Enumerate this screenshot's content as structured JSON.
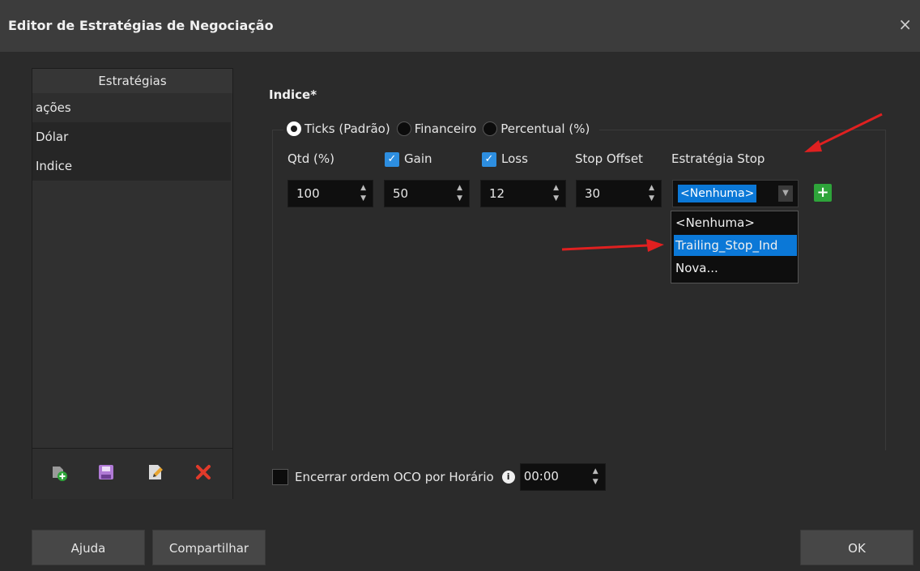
{
  "window": {
    "title": "Editor de Estratégias de Negociação",
    "close_glyph": "×"
  },
  "sidebar": {
    "header": "Estratégias",
    "items": [
      "ações",
      "Dólar",
      "Indice"
    ],
    "toolbar": {
      "new_icon": "new-strategy-icon",
      "save_icon": "save-icon",
      "edit_icon": "edit-icon",
      "delete_icon": "delete-icon"
    }
  },
  "main": {
    "title": "Indice*",
    "radios": [
      "Ticks (Padrão)",
      "Financeiro",
      "Percentual (%)"
    ],
    "columns": {
      "qtd": "Qtd (%)",
      "gain": "Gain",
      "loss": "Loss",
      "stop_offset": "Stop Offset",
      "strategy_stop": "Estratégia Stop"
    },
    "values": {
      "qtd": "100",
      "gain": "50",
      "loss": "12",
      "stop_offset": "30"
    },
    "combo_selected": "<Nenhuma>",
    "add_glyph": "+",
    "dropdown_options": [
      "<Nenhuma>",
      "Trailing_Stop_Ind",
      "Nova..."
    ],
    "close_by_time_label": "Encerrar ordem OCO por Horário",
    "time_value": "00:00"
  },
  "buttons": {
    "help": "Ajuda",
    "share": "Compartilhar",
    "ok": "OK"
  },
  "colors": {
    "accent": "#0b78d7",
    "check": "#2d8ee0",
    "plus": "#2ea43a",
    "annotation_arrow": "#e02020"
  }
}
